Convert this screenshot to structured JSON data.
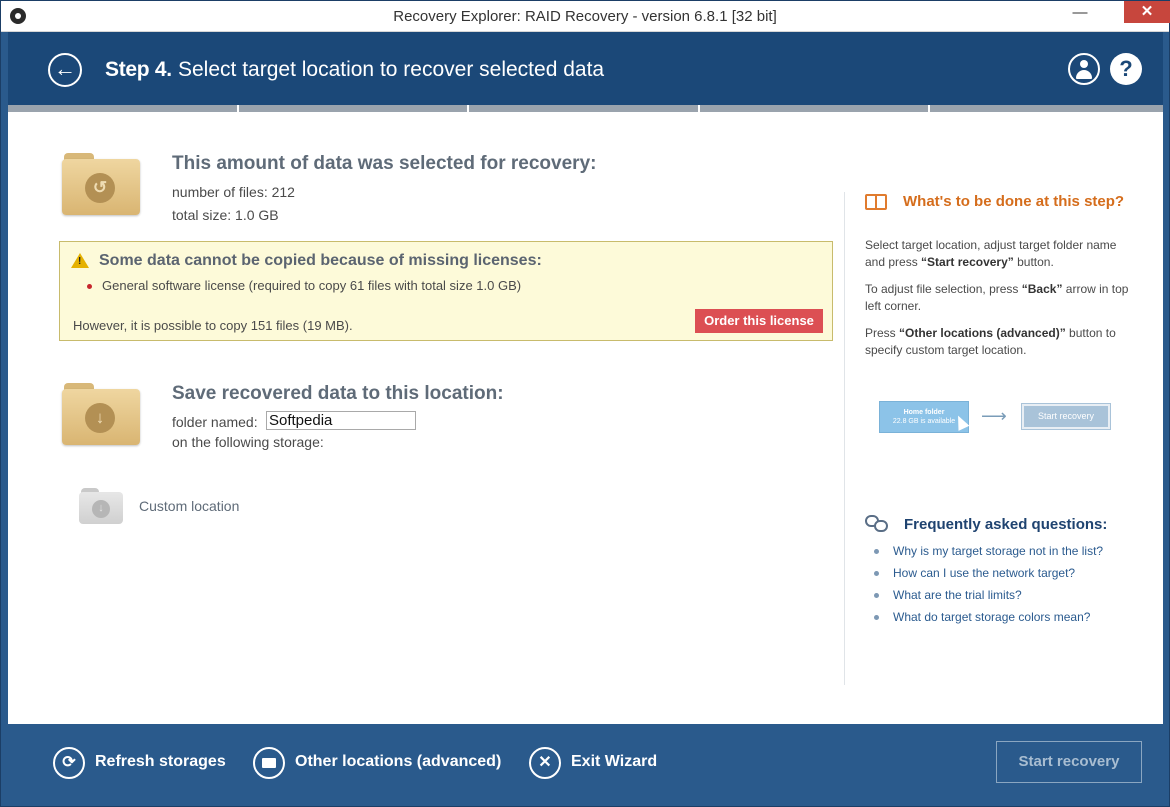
{
  "window": {
    "title": "Recovery Explorer: RAID Recovery - version 6.8.1 [32 bit]",
    "minimize_glyph": "—",
    "close_glyph": "✕"
  },
  "header": {
    "back_icon": "←",
    "step_label": "Step 4.",
    "step_text": "Select target location to recover selected data",
    "help_icon": "?"
  },
  "selection": {
    "title": "This amount of data was selected for recovery:",
    "files_line": "number of files: 212",
    "size_line": "total size: 1.0 GB"
  },
  "warning": {
    "icon": "!",
    "title": "Some data cannot be copied because of missing licenses:",
    "item": "General software license (required to copy 61 files with total size 1.0 GB)",
    "footer": "However, it is possible to copy 151 files (19 MB).",
    "order_button": "Order this license",
    "order_color": "#dc4f53"
  },
  "save": {
    "title": "Save recovered data to this location:",
    "folder_label": "folder named:",
    "folder_value": "Softpedia",
    "storage_line": "on the following storage:",
    "custom_location": "Custom location"
  },
  "side": {
    "title": "What's to be done at this step?",
    "p1_pre": "Select target location, adjust target folder name and press ",
    "p1_bold": "“Start recovery”",
    "p1_post": " button.",
    "p2_pre": "To adjust file selection, press ",
    "p2_bold": "“Back”",
    "p2_post": " arrow in top left corner.",
    "p3_bold": "“Other locations (advanced)”",
    "p3_pre": "Press ",
    "p3_post": " button to specify custom target location.",
    "illus_home": "Home folder",
    "illus_home_sub": "22.8 GB is available",
    "illus_start": "Start recovery",
    "faq_title": "Frequently asked questions:",
    "faq": [
      "Why is my target storage not in the list?",
      "How can I use the network target?",
      "What are the trial limits?",
      "What do target storage colors mean?"
    ]
  },
  "footer": {
    "refresh": "Refresh storages",
    "other": "Other locations (advanced)",
    "exit": "Exit Wizard",
    "start": "Start recovery",
    "refresh_icon": "⟳",
    "exit_icon": "✕"
  }
}
